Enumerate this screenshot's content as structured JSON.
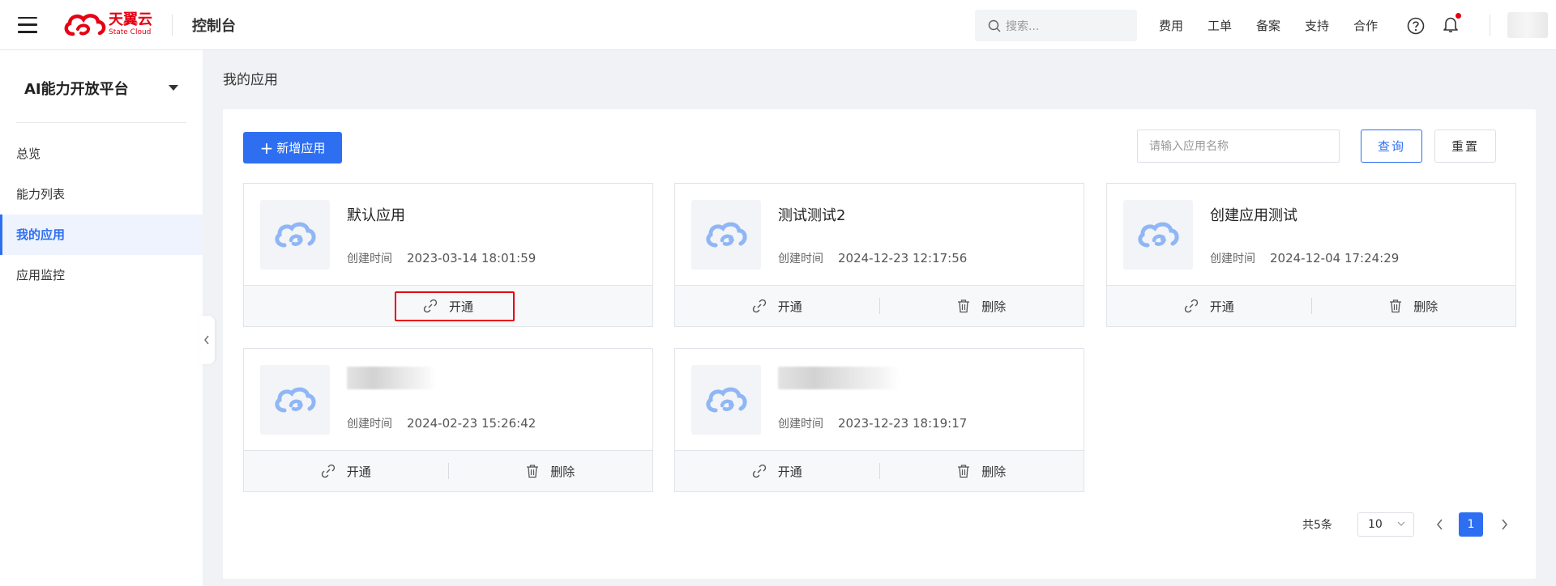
{
  "header": {
    "brand_name": "天翼云",
    "brand_sub": "State Cloud",
    "console_title": "控制台",
    "search_placeholder": "搜索...",
    "nav": [
      "费用",
      "工单",
      "备案",
      "支持",
      "合作"
    ],
    "colors": {
      "brand": "#e60012",
      "primary": "#2e6ff2"
    }
  },
  "sidebar": {
    "platform_title": "AI能力开放平台",
    "items": [
      {
        "label": "总览",
        "active": false
      },
      {
        "label": "能力列表",
        "active": false
      },
      {
        "label": "我的应用",
        "active": true
      },
      {
        "label": "应用监控",
        "active": false
      }
    ]
  },
  "main": {
    "breadcrumb": "我的应用",
    "add_button": "新增应用",
    "name_input_placeholder": "请输入应用名称",
    "query_button": "查询",
    "reset_button": "重置",
    "created_label": "创建时间",
    "open_label": "开通",
    "delete_label": "删除",
    "apps": [
      {
        "name": "默认应用",
        "created": "2023-03-14 18:01:59",
        "blurred": false,
        "deletable": false,
        "highlighted": true
      },
      {
        "name": "测试测试2",
        "created": "2024-12-23 12:17:56",
        "blurred": false,
        "deletable": true,
        "highlighted": false
      },
      {
        "name": "创建应用测试",
        "created": "2024-12-04 17:24:29",
        "blurred": false,
        "deletable": true,
        "highlighted": false
      },
      {
        "name": "",
        "created": "2024-02-23 15:26:42",
        "blurred": true,
        "deletable": true,
        "highlighted": false
      },
      {
        "name": "",
        "created": "2023-12-23 18:19:17",
        "blurred": true,
        "deletable": true,
        "highlighted": false
      }
    ]
  },
  "pagination": {
    "total_text": "共5条",
    "page_size": "10",
    "current_page": "1"
  }
}
